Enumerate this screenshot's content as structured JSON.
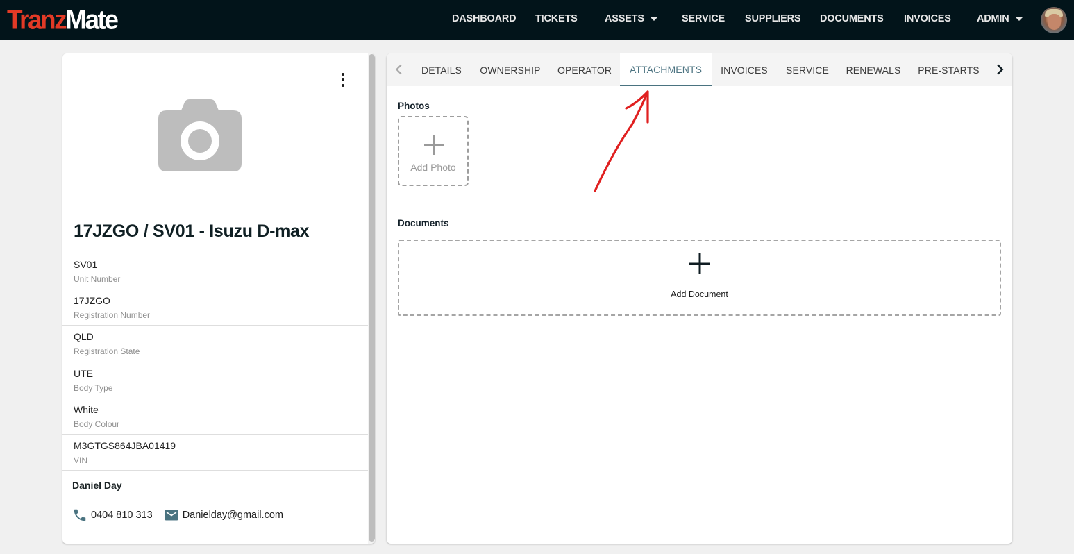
{
  "app": {
    "logo_part1": "Tranz",
    "logo_part2": "Mate",
    "brand_color": "#e23a26",
    "topbar_color": "#02141a"
  },
  "nav": {
    "items": [
      {
        "label": "DASHBOARD",
        "dropdown": false
      },
      {
        "label": "TICKETS",
        "dropdown": false
      },
      {
        "label": "ASSETS",
        "dropdown": true
      },
      {
        "label": "SERVICE",
        "dropdown": false
      },
      {
        "label": "SUPPLIERS",
        "dropdown": false
      },
      {
        "label": "DOCUMENTS",
        "dropdown": false
      },
      {
        "label": "INVOICES",
        "dropdown": false
      },
      {
        "label": "ADMIN",
        "dropdown": true
      }
    ],
    "avatar_icon": "user-avatar"
  },
  "asset": {
    "menu_icon": "kebab-menu-icon",
    "photo_placeholder_icon": "camera-icon",
    "title": "17JZGO / SV01 - Isuzu D-max",
    "fields": [
      {
        "value": "SV01",
        "label": "Unit Number"
      },
      {
        "value": "17JZGO",
        "label": "Registration Number"
      },
      {
        "value": "QLD",
        "label": "Registration State"
      },
      {
        "value": "UTE",
        "label": "Body Type"
      },
      {
        "value": "White",
        "label": "Body Colour"
      },
      {
        "value": "M3GTGS864JBA01419",
        "label": "VIN"
      }
    ],
    "operator": {
      "name": "Daniel Day",
      "phone": "0404 810 313",
      "email": "Danielday@gmail.com",
      "phone_icon": "phone-icon",
      "email_icon": "email-icon",
      "icon_color": "#4a7380"
    }
  },
  "tabs": {
    "items": [
      {
        "label": "DETAILS",
        "active": false
      },
      {
        "label": "OWNERSHIP",
        "active": false
      },
      {
        "label": "OPERATOR",
        "active": false
      },
      {
        "label": "ATTACHMENTS",
        "active": true
      },
      {
        "label": "INVOICES",
        "active": false
      },
      {
        "label": "SERVICE",
        "active": false
      },
      {
        "label": "RENEWALS",
        "active": false
      },
      {
        "label": "PRE-STARTS",
        "active": false
      }
    ],
    "active_color": "#4a7380"
  },
  "attachments": {
    "photos_label": "Photos",
    "add_photo_label": "Add Photo",
    "documents_label": "Documents",
    "add_document_label": "Add Document"
  },
  "annotation": {
    "arrow_color": "#e02020",
    "points_to": "ATTACHMENTS tab"
  }
}
